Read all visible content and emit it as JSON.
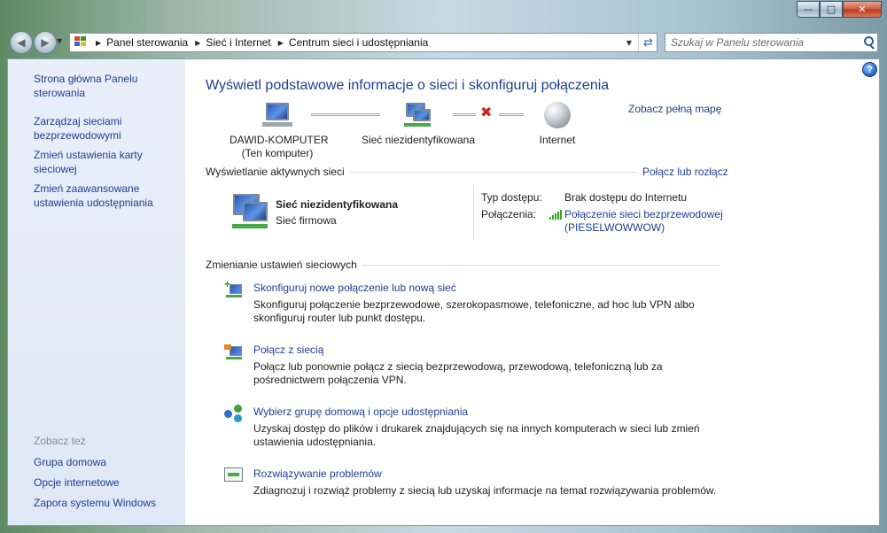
{
  "window": {
    "caption_buttons": [
      "minimize-icon",
      "maximize-icon",
      "close-icon"
    ]
  },
  "nav": {
    "breadcrumbs": [
      "Panel sterowania",
      "Sieć i Internet",
      "Centrum sieci i udostępniania"
    ],
    "search_placeholder": "Szukaj w Panelu sterowania"
  },
  "sidebar": {
    "links": [
      "Strona główna Panelu sterowania",
      "Zarządzaj sieciami bezprzewodowymi",
      "Zmień ustawienia karty sieciowej",
      "Zmień zaawansowane ustawienia udostępniania"
    ],
    "see_also_heading": "Zobacz też",
    "see_also": [
      "Grupa domowa",
      "Opcje internetowe",
      "Zapora systemu Windows"
    ]
  },
  "main": {
    "title": "Wyświetl podstawowe informacje o sieci i skonfiguruj połączenia",
    "map": {
      "full_map_link": "Zobacz pełną mapę",
      "computer_name": "DAWID-KOMPUTER",
      "computer_sub": "(Ten komputer)",
      "network_name": "Sieć niezidentyfikowana",
      "internet": "Internet"
    },
    "active": {
      "heading": "Wyświetlanie aktywnych sieci",
      "connect_link": "Połącz lub rozłącz",
      "network_name": "Sieć niezidentyfikowana",
      "network_type": "Sieć firmowa",
      "access_label": "Typ dostępu:",
      "access_value": "Brak dostępu do Internetu",
      "connections_label": "Połączenia:",
      "connection_name": "Połączenie sieci bezprzewodowej",
      "connection_ssid": "(PIESELWOWWOW)"
    },
    "change": {
      "heading": "Zmienianie ustawień sieciowych",
      "tasks": [
        {
          "title": "Skonfiguruj nowe połączenie lub nową sieć",
          "desc": "Skonfiguruj połączenie bezprzewodowe, szerokopasmowe, telefoniczne, ad hoc lub VPN albo skonfiguruj router lub punkt dostępu."
        },
        {
          "title": "Połącz z siecią",
          "desc": "Połącz lub ponownie połącz z siecią bezprzewodową, przewodową, telefoniczną lub za pośrednictwem połączenia VPN."
        },
        {
          "title": "Wybierz grupę domową i opcje udostępniania",
          "desc": "Uzyskaj dostęp do plików i drukarek znajdujących się na innych komputerach w sieci lub zmień ustawienia udostępniania."
        },
        {
          "title": "Rozwiązywanie problemów",
          "desc": "Zdiagnozuj i rozwiąż problemy z siecią lub uzyskaj informacje na temat rozwiązywania problemów."
        }
      ]
    }
  },
  "colors": {
    "link": "#1c3f94",
    "title": "#1e3f8c",
    "sidebar_bg": "#e4ecf7",
    "signal": "#34a51d",
    "error": "#d51f1f"
  }
}
